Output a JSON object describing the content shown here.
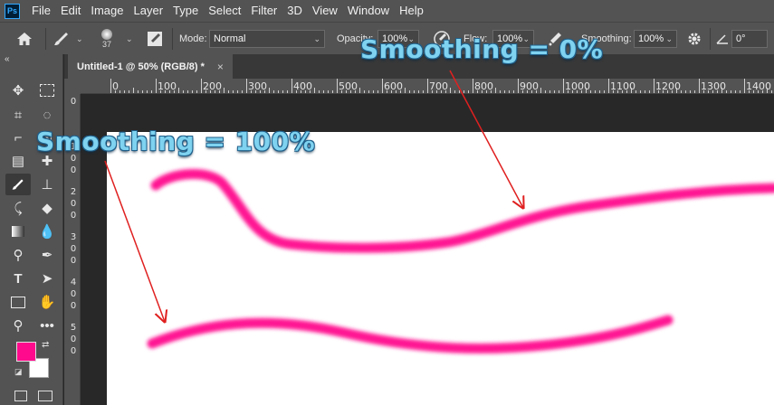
{
  "app": {
    "logo": "Ps"
  },
  "menu": [
    "File",
    "Edit",
    "Image",
    "Layer",
    "Type",
    "Select",
    "Filter",
    "3D",
    "View",
    "Window",
    "Help"
  ],
  "options": {
    "brush_size": "37",
    "mode_label": "Mode:",
    "mode_value": "Normal",
    "opacity_label": "Opacity:",
    "opacity_value": "100%",
    "flow_label": "Flow:",
    "flow_value": "100%",
    "smoothing_label": "Smoothing:",
    "smoothing_value": "100%",
    "angle_value": "0°"
  },
  "document": {
    "tab_title": "Untitled-1 @ 50% (RGB/8) *",
    "close_glyph": "×"
  },
  "rulers": {
    "horizontal": [
      "0",
      "100",
      "200",
      "300",
      "400",
      "500",
      "600",
      "700",
      "800",
      "900",
      "1000",
      "1100",
      "1200",
      "1300",
      "1400"
    ],
    "vertical": [
      "0",
      "100",
      "200",
      "300",
      "400",
      "500"
    ]
  },
  "annotations": {
    "smoothing_zero": "Smoothing = 0%",
    "smoothing_full": "Smoothing = 100%"
  },
  "colors": {
    "foreground": "#ff0a8c",
    "background": "#ffffff",
    "stroke": "#ff1493",
    "arrow": "#e02020"
  }
}
